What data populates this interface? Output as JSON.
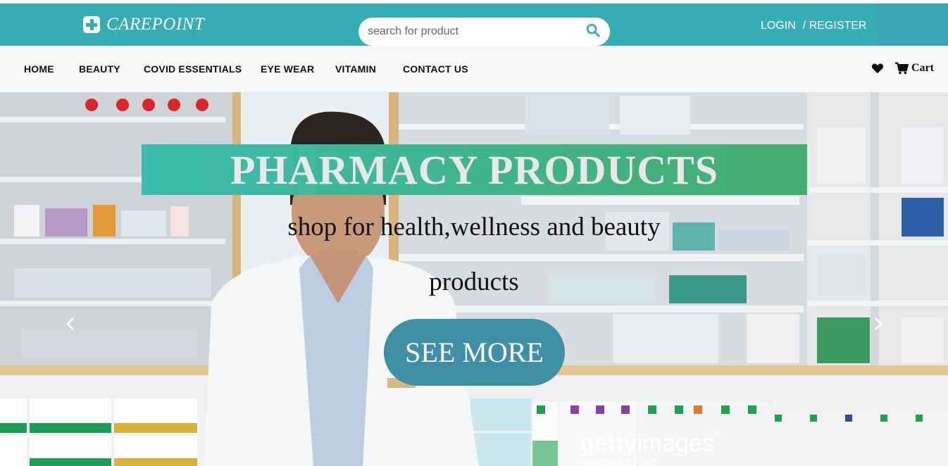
{
  "brand": {
    "name": "CAREPOINT"
  },
  "search": {
    "placeholder": "search for product"
  },
  "auth": {
    "login": "LOGIN",
    "register": "/ REGISTER"
  },
  "nav": {
    "items": [
      {
        "label": "HOME"
      },
      {
        "label": "BEAUTY"
      },
      {
        "label": "COVID ESSENTIALS"
      },
      {
        "label": "EYE WEAR"
      },
      {
        "label": "VITAMIN"
      },
      {
        "label": "CONTACT US"
      }
    ],
    "cart_label": "Cart"
  },
  "hero": {
    "title": "PHARMACY PRODUCTS",
    "subtitle_line1": "shop for health,wellness and beauty",
    "subtitle_line2": "products",
    "cta": "SEE MORE",
    "watermark_brand_bold": "getty",
    "watermark_brand_light": "images",
    "watermark_credit": "Alexander Ford"
  },
  "colors": {
    "header": "#35aeb4",
    "banner_start": "#3bbcae",
    "banner_end": "#45ad6e",
    "cta": "#3e90a4",
    "nav_bg": "#f7f8fa"
  },
  "icons": [
    "plus-square-icon",
    "search-icon",
    "heart-icon",
    "cart-icon",
    "chevron-left-icon",
    "chevron-right-icon"
  ]
}
